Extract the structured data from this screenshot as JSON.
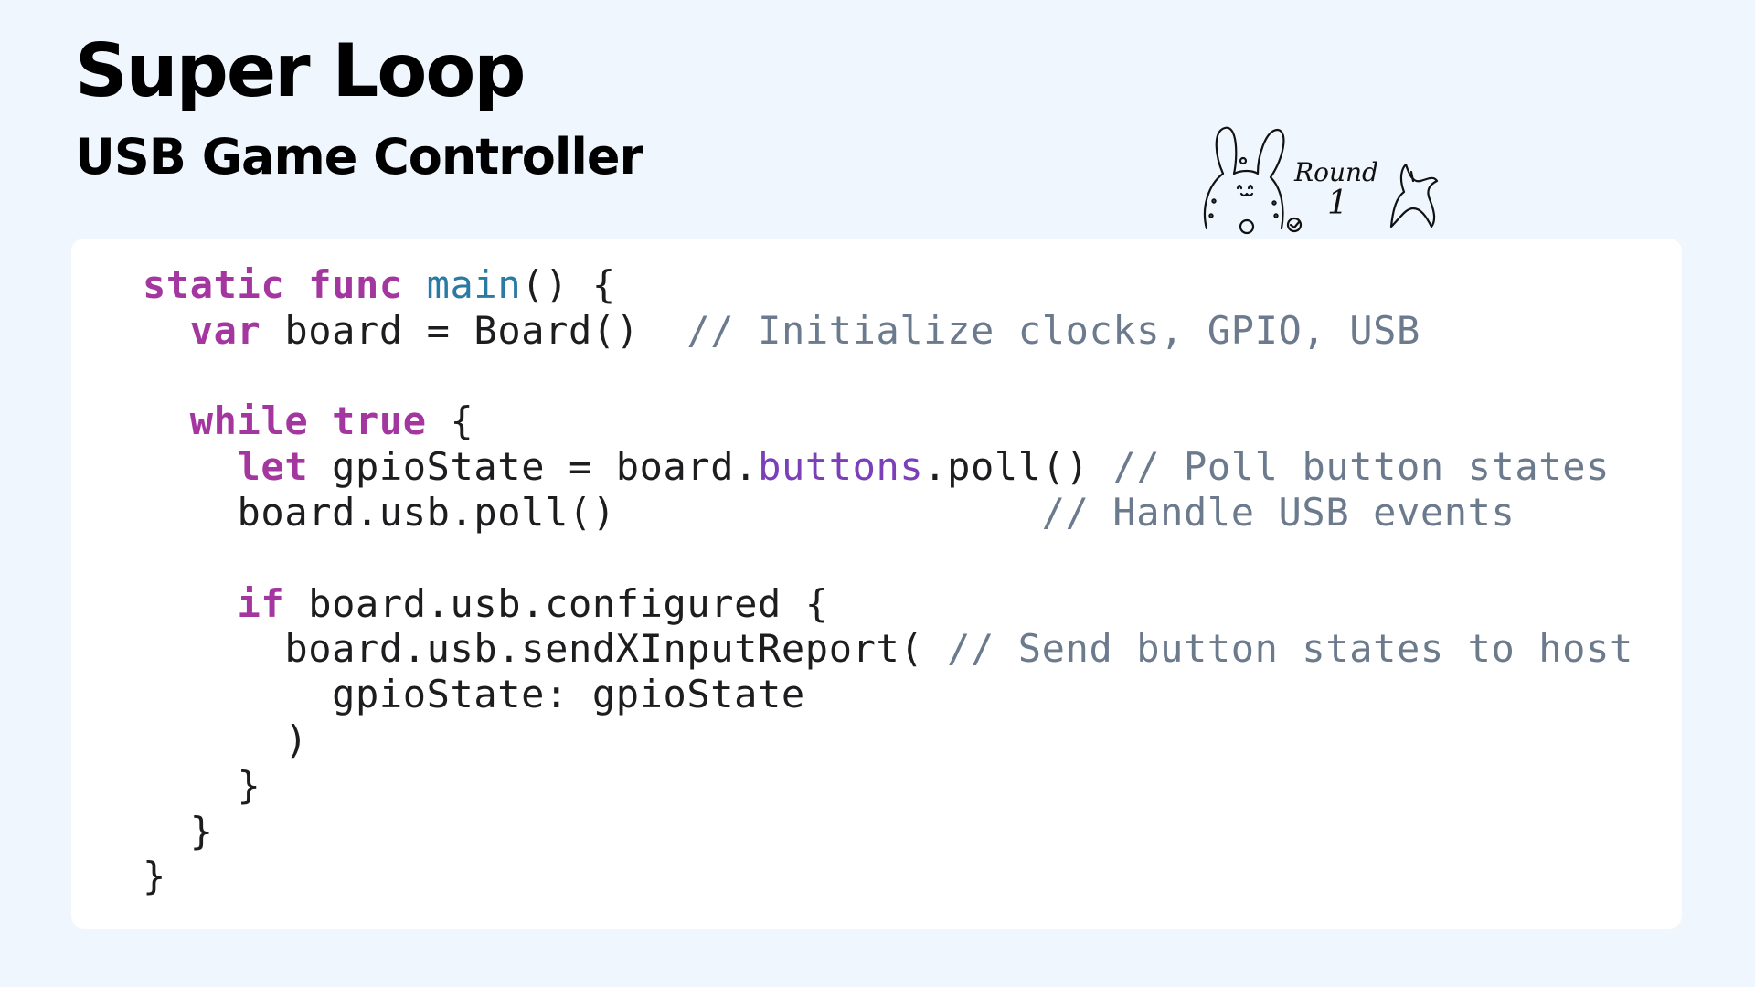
{
  "slide": {
    "title": "Super Loop",
    "subtitle": "USB Game Controller"
  },
  "mascot": {
    "icon": "bunny-round-1-illustration",
    "text_round": "Round",
    "text_number": "1"
  },
  "colors": {
    "background": "#eff6fe",
    "card": "#ffffff",
    "keyword": "#a4379f",
    "function_name": "#2a7aa3",
    "property": "#7b3fb8",
    "comment": "#6c7a8d",
    "text": "#1d1d1f"
  },
  "code": {
    "language": "swift",
    "lines": [
      [
        {
          "t": "static",
          "c": "kw"
        },
        {
          "t": " "
        },
        {
          "t": "func",
          "c": "kw"
        },
        {
          "t": " "
        },
        {
          "t": "main",
          "c": "fn"
        },
        {
          "t": "() {"
        }
      ],
      [
        {
          "t": "  "
        },
        {
          "t": "var",
          "c": "kw"
        },
        {
          "t": " board = Board()  "
        },
        {
          "t": "// Initialize clocks, GPIO, USB",
          "c": "cm"
        }
      ],
      [],
      [
        {
          "t": "  "
        },
        {
          "t": "while",
          "c": "kw"
        },
        {
          "t": " "
        },
        {
          "t": "true",
          "c": "kw"
        },
        {
          "t": " {"
        }
      ],
      [
        {
          "t": "    "
        },
        {
          "t": "let",
          "c": "kw"
        },
        {
          "t": " gpioState = board."
        },
        {
          "t": "buttons",
          "c": "prop"
        },
        {
          "t": ".poll() "
        },
        {
          "t": "// Poll button states",
          "c": "cm"
        }
      ],
      [
        {
          "t": "    board.usb.poll()                  "
        },
        {
          "t": "// Handle USB events",
          "c": "cm"
        }
      ],
      [],
      [
        {
          "t": "    "
        },
        {
          "t": "if",
          "c": "kw"
        },
        {
          "t": " board.usb.configured {"
        }
      ],
      [
        {
          "t": "      board.usb.sendXInputReport( "
        },
        {
          "t": "// Send button states to host",
          "c": "cm"
        }
      ],
      [
        {
          "t": "        gpioState: gpioState"
        }
      ],
      [
        {
          "t": "      )"
        }
      ],
      [
        {
          "t": "    }"
        }
      ],
      [
        {
          "t": "  }"
        }
      ],
      [
        {
          "t": "}"
        }
      ]
    ]
  }
}
